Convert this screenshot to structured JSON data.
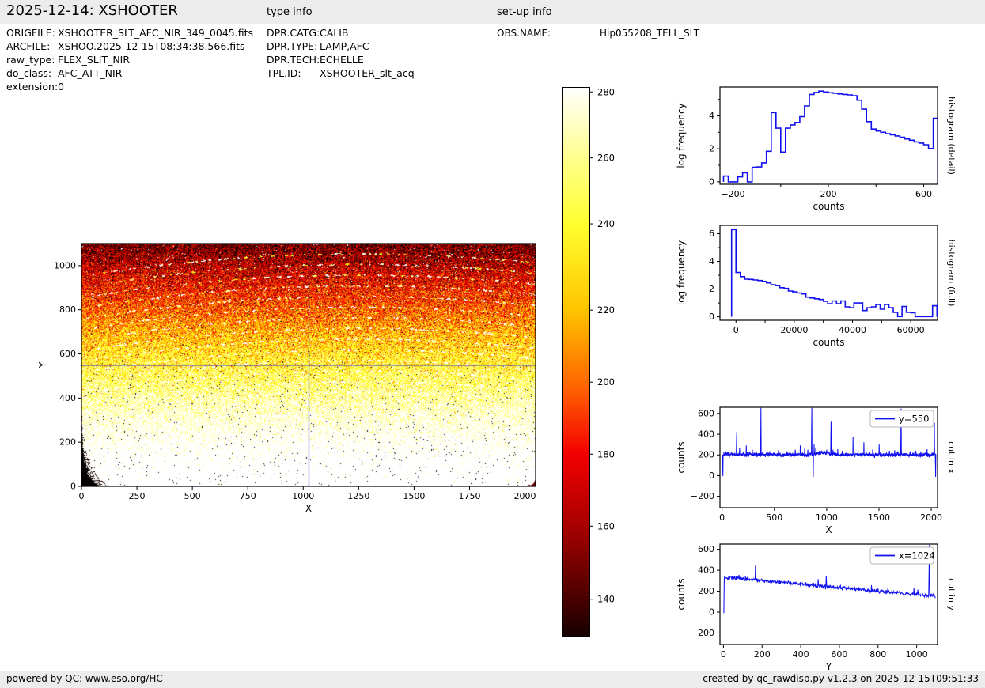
{
  "header": {
    "title": "2025-12-14: XSHOOTER",
    "type_info": "type info",
    "setup_info": "set-up info"
  },
  "file_info": [
    {
      "label": "ORIGFILE:",
      "value": "XSHOOTER_SLT_AFC_NIR_349_0045.fits"
    },
    {
      "label": "ARCFILE:",
      "value": "XSHOO.2025-12-15T08:34:38.566.fits"
    },
    {
      "label": "raw_type:",
      "value": "FLEX_SLIT_NIR"
    },
    {
      "label": "do_class:",
      "value": "AFC_ATT_NIR"
    },
    {
      "label": "extension:",
      "value": "0"
    }
  ],
  "type_info": [
    {
      "label": "DPR.CATG:",
      "value": "CALIB"
    },
    {
      "label": "DPR.TYPE:",
      "value": "LAMP,AFC"
    },
    {
      "label": "DPR.TECH:",
      "value": "ECHELLE"
    },
    {
      "label": "TPL.ID:",
      "value": "XSHOOTER_slt_acq"
    }
  ],
  "setup_info": [
    {
      "label": "OBS.NAME:",
      "value": "Hip055208_TELL_SLT"
    }
  ],
  "footer": {
    "left": "powered by QC: www.eso.org/HC",
    "right": "created by qc_rawdisp.py v1.2.3 on 2025-12-15T09:51:33"
  },
  "colors": {
    "line_blue": "#1010ee",
    "crosshair_blue": "#2222cc",
    "bar_bg": "#ececec",
    "colorbar_stops": [
      [
        "0%",
        "#ffffff"
      ],
      [
        "1%",
        "#fffff4"
      ],
      [
        "13%",
        "#ffff8c"
      ],
      [
        "25%",
        "#ffff2e"
      ],
      [
        "40.6%",
        "#ffc400"
      ],
      [
        "53.7%",
        "#ff6a00"
      ],
      [
        "66.8%",
        "#f40000"
      ],
      [
        "79.9%",
        "#a80000"
      ],
      [
        "93.2%",
        "#4a0000"
      ],
      [
        "100%",
        "#170000"
      ]
    ]
  },
  "chart_data": [
    {
      "id": "main_image",
      "type": "heatmap",
      "xlabel": "X",
      "ylabel": "Y",
      "xlim": [
        0,
        2048
      ],
      "ylim": [
        0,
        1100
      ],
      "xticks": [
        {
          "v": 0,
          "l": "0"
        },
        {
          "v": 250,
          "l": "250"
        },
        {
          "v": 500,
          "l": "500"
        },
        {
          "v": 750,
          "l": "750"
        },
        {
          "v": 1000,
          "l": "1000"
        },
        {
          "v": 1250,
          "l": "1250"
        },
        {
          "v": 1500,
          "l": "1500"
        },
        {
          "v": 1750,
          "l": "1750"
        },
        {
          "v": 2000,
          "l": "2000"
        }
      ],
      "yticks": [
        {
          "v": 0,
          "l": "0"
        },
        {
          "v": 200,
          "l": "200"
        },
        {
          "v": 400,
          "l": "400"
        },
        {
          "v": 600,
          "l": "600"
        },
        {
          "v": 800,
          "l": "800"
        },
        {
          "v": 1000,
          "l": "1000"
        }
      ],
      "crosshair": {
        "x": 1024,
        "y": 550
      },
      "colormap": "hot",
      "vmin": 125,
      "vmax": 285,
      "base_counts_at_y0": 338,
      "base_counts_at_ymax": 148,
      "noise_sigma": 20,
      "arcs": {
        "count": 16,
        "y_first": 330,
        "y_last": 1055,
        "x_center": 1250,
        "curvature": 6.5e-05
      },
      "colorbar": {
        "tick_values": [
          "280",
          "260",
          "240",
          "220",
          "200",
          "180",
          "160",
          "140"
        ],
        "tick_fracs": [
          0.009,
          0.129,
          0.249,
          0.406,
          0.537,
          0.668,
          0.799,
          0.932
        ]
      }
    },
    {
      "id": "hist_detail",
      "type": "step",
      "xlabel": "counts",
      "ylabel": "log frequency",
      "right_label": "histogram (detail)",
      "xlim": [
        -255,
        658
      ],
      "ylim": [
        -0.15,
        5.75
      ],
      "xticks": [
        {
          "v": -200,
          "l": "−200"
        },
        {
          "v": 0,
          "l": ""
        },
        {
          "v": 200,
          "l": "200"
        },
        {
          "v": 400,
          "l": ""
        },
        {
          "v": 600,
          "l": "600"
        }
      ],
      "yticks": [
        {
          "v": 0,
          "l": "0"
        },
        {
          "v": 1,
          "l": "",
          "minor": true
        },
        {
          "v": 2,
          "l": "2"
        },
        {
          "v": 3,
          "l": "",
          "minor": true
        },
        {
          "v": 4,
          "l": "4"
        },
        {
          "v": 5,
          "l": "",
          "minor": true
        }
      ],
      "bin_width": 20,
      "bins": [
        [
          -240,
          0.35
        ],
        [
          -220,
          0
        ],
        [
          -200,
          0
        ],
        [
          -180,
          0.3
        ],
        [
          -160,
          0.55
        ],
        [
          -140,
          0
        ],
        [
          -120,
          0.88
        ],
        [
          -100,
          0.9
        ],
        [
          -80,
          1.15
        ],
        [
          -60,
          1.85
        ],
        [
          -40,
          4.2
        ],
        [
          -20,
          3.25
        ],
        [
          0,
          1.8
        ],
        [
          20,
          3.25
        ],
        [
          40,
          3.45
        ],
        [
          60,
          3.6
        ],
        [
          80,
          3.95
        ],
        [
          100,
          4.6
        ],
        [
          120,
          5.3
        ],
        [
          140,
          5.42
        ],
        [
          160,
          5.5
        ],
        [
          180,
          5.45
        ],
        [
          200,
          5.4
        ],
        [
          220,
          5.37
        ],
        [
          240,
          5.33
        ],
        [
          260,
          5.3
        ],
        [
          280,
          5.27
        ],
        [
          300,
          5.22
        ],
        [
          320,
          4.95
        ],
        [
          340,
          4.4
        ],
        [
          360,
          3.65
        ],
        [
          380,
          3.2
        ],
        [
          400,
          3.08
        ],
        [
          420,
          3.0
        ],
        [
          440,
          2.92
        ],
        [
          460,
          2.85
        ],
        [
          480,
          2.78
        ],
        [
          500,
          2.7
        ],
        [
          520,
          2.6
        ],
        [
          540,
          2.52
        ],
        [
          560,
          2.42
        ],
        [
          580,
          2.35
        ],
        [
          600,
          2.25
        ],
        [
          620,
          2.02
        ],
        [
          640,
          3.85
        ]
      ]
    },
    {
      "id": "hist_full",
      "type": "step",
      "xlabel": "counts",
      "ylabel": "log frequency",
      "right_label": "histogram (full)",
      "xlim": [
        -5500,
        69200
      ],
      "ylim": [
        -0.25,
        6.6
      ],
      "xticks": [
        {
          "v": 0,
          "l": "0"
        },
        {
          "v": 10000,
          "l": ""
        },
        {
          "v": 20000,
          "l": "20000"
        },
        {
          "v": 30000,
          "l": ""
        },
        {
          "v": 40000,
          "l": "40000"
        },
        {
          "v": 50000,
          "l": ""
        },
        {
          "v": 60000,
          "l": "60000"
        }
      ],
      "yticks": [
        {
          "v": 0,
          "l": "0"
        },
        {
          "v": 1,
          "l": "",
          "minor": true
        },
        {
          "v": 2,
          "l": "2"
        },
        {
          "v": 3,
          "l": "",
          "minor": true
        },
        {
          "v": 4,
          "l": "4"
        },
        {
          "v": 5,
          "l": "",
          "minor": true
        },
        {
          "v": 6,
          "l": "6"
        }
      ],
      "bin_width": 1500,
      "bins": [
        [
          -1500,
          6.3
        ],
        [
          0,
          3.2
        ],
        [
          1500,
          2.9
        ],
        [
          3000,
          2.72
        ],
        [
          4500,
          2.7
        ],
        [
          6000,
          2.66
        ],
        [
          7500,
          2.62
        ],
        [
          9000,
          2.56
        ],
        [
          10500,
          2.45
        ],
        [
          12000,
          2.32
        ],
        [
          13500,
          2.25
        ],
        [
          15000,
          2.1
        ],
        [
          16500,
          2.05
        ],
        [
          18000,
          1.86
        ],
        [
          19500,
          1.8
        ],
        [
          21000,
          1.72
        ],
        [
          22500,
          1.65
        ],
        [
          24000,
          1.42
        ],
        [
          25500,
          1.36
        ],
        [
          27000,
          1.3
        ],
        [
          28500,
          1.25
        ],
        [
          30000,
          1.12
        ],
        [
          31500,
          0.95
        ],
        [
          33000,
          1.15
        ],
        [
          34500,
          0.95
        ],
        [
          36000,
          1.15
        ],
        [
          37500,
          0.72
        ],
        [
          39000,
          0.65
        ],
        [
          40500,
          1.0
        ],
        [
          42000,
          1.0
        ],
        [
          43500,
          0.45
        ],
        [
          45000,
          0.65
        ],
        [
          46500,
          0.72
        ],
        [
          48000,
          0.9
        ],
        [
          49500,
          0.55
        ],
        [
          51000,
          0.9
        ],
        [
          52500,
          0.66
        ],
        [
          54000,
          0.32
        ],
        [
          55500,
          0.02
        ],
        [
          57000,
          0.75
        ],
        [
          58500,
          0.32
        ],
        [
          60000,
          0.3
        ],
        [
          61500,
          0.02
        ],
        [
          63000,
          0.02
        ],
        [
          64500,
          0.02
        ],
        [
          66000,
          0.02
        ],
        [
          67500,
          0.8
        ]
      ]
    },
    {
      "id": "cut_x",
      "type": "noisy_line",
      "legend": "y=550",
      "xlabel": "X",
      "ylabel": "counts",
      "right_label": "cut in x",
      "xlim": [
        -20,
        2060
      ],
      "ylim": [
        -310,
        660
      ],
      "xticks": [
        {
          "v": 0,
          "l": "0"
        },
        {
          "v": 500,
          "l": "500"
        },
        {
          "v": 1000,
          "l": "1000"
        },
        {
          "v": 1500,
          "l": "1500"
        },
        {
          "v": 2000,
          "l": "2000"
        }
      ],
      "yticks": [
        {
          "v": -200,
          "l": "−200"
        },
        {
          "v": 0,
          "l": "0"
        },
        {
          "v": 200,
          "l": "200"
        },
        {
          "v": 400,
          "l": "400"
        },
        {
          "v": 600,
          "l": "600"
        }
      ],
      "seed": 7,
      "x_start": 2,
      "x_end": 2046,
      "x_step": 2,
      "base_start": 203,
      "base_end": 203,
      "bump": {
        "x0": 840,
        "x1": 1070,
        "amp": 18
      },
      "noise_sigma": 10,
      "spikes": [
        [
          8,
          -5
        ],
        [
          140,
          420
        ],
        [
          168,
          265
        ],
        [
          232,
          292
        ],
        [
          290,
          250
        ],
        [
          372,
          655
        ],
        [
          455,
          235
        ],
        [
          540,
          245
        ],
        [
          620,
          235
        ],
        [
          700,
          250
        ],
        [
          748,
          292
        ],
        [
          790,
          262
        ],
        [
          820,
          250
        ],
        [
          858,
          655
        ],
        [
          872,
          -12
        ],
        [
          880,
          300
        ],
        [
          895,
          265
        ],
        [
          930,
          240
        ],
        [
          1000,
          250
        ],
        [
          1042,
          520
        ],
        [
          1060,
          250
        ],
        [
          1105,
          255
        ],
        [
          1150,
          240
        ],
        [
          1252,
          370
        ],
        [
          1300,
          245
        ],
        [
          1355,
          322
        ],
        [
          1440,
          252
        ],
        [
          1502,
          300
        ],
        [
          1600,
          240
        ],
        [
          1650,
          245
        ],
        [
          1712,
          648
        ],
        [
          1800,
          235
        ],
        [
          1850,
          242
        ],
        [
          1960,
          255
        ],
        [
          2030,
          510
        ],
        [
          2042,
          -12
        ]
      ]
    },
    {
      "id": "cut_y",
      "type": "noisy_line",
      "legend": "x=1024",
      "xlabel": "Y",
      "ylabel": "counts",
      "right_label": "cut in y",
      "xlim": [
        -18,
        1108
      ],
      "ylim": [
        -310,
        650
      ],
      "xticks": [
        {
          "v": 0,
          "l": "0"
        },
        {
          "v": 200,
          "l": "200"
        },
        {
          "v": 400,
          "l": "400"
        },
        {
          "v": 600,
          "l": "600"
        },
        {
          "v": 800,
          "l": "800"
        },
        {
          "v": 1000,
          "l": "1000"
        }
      ],
      "yticks": [
        {
          "v": -200,
          "l": "−200"
        },
        {
          "v": 0,
          "l": "0"
        },
        {
          "v": 200,
          "l": "200"
        },
        {
          "v": 400,
          "l": "400"
        },
        {
          "v": 600,
          "l": "600"
        }
      ],
      "seed": 13,
      "x_start": 2,
      "x_end": 1098,
      "x_step": 2,
      "base_start": 335,
      "base_end": 150,
      "noise_sigma": 9,
      "spikes": [
        [
          2,
          -10
        ],
        [
          80,
          355
        ],
        [
          165,
          445
        ],
        [
          230,
          302
        ],
        [
          300,
          288
        ],
        [
          360,
          270
        ],
        [
          425,
          285
        ],
        [
          460,
          275
        ],
        [
          490,
          315
        ],
        [
          532,
          345
        ],
        [
          570,
          255
        ],
        [
          620,
          250
        ],
        [
          700,
          238
        ],
        [
          765,
          258
        ],
        [
          800,
          225
        ],
        [
          850,
          215
        ],
        [
          900,
          200
        ],
        [
          985,
          228
        ],
        [
          1005,
          215
        ],
        [
          1065,
          645
        ],
        [
          1090,
          165
        ]
      ]
    }
  ]
}
